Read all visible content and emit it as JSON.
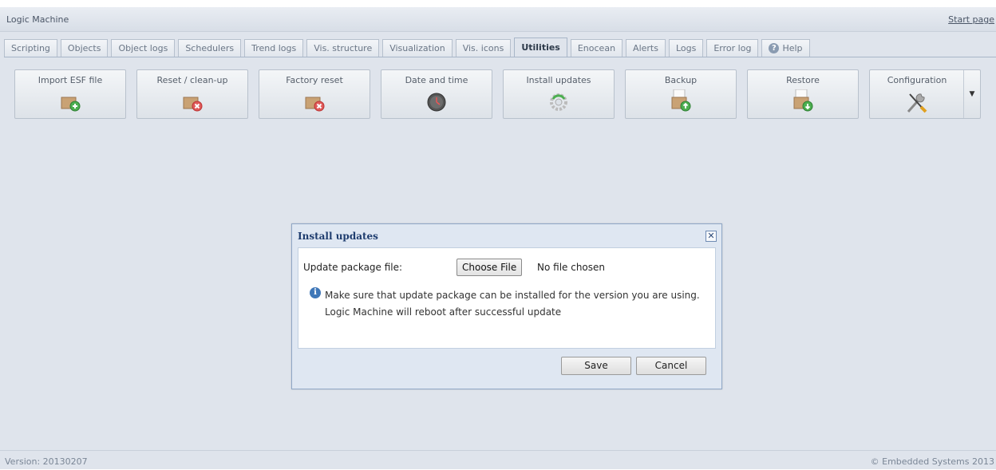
{
  "header": {
    "title": "Logic Machine",
    "start_page": "Start page"
  },
  "tabs": [
    {
      "label": "Scripting"
    },
    {
      "label": "Objects"
    },
    {
      "label": "Object logs"
    },
    {
      "label": "Schedulers"
    },
    {
      "label": "Trend logs"
    },
    {
      "label": "Vis. structure"
    },
    {
      "label": "Visualization"
    },
    {
      "label": "Vis. icons"
    },
    {
      "label": "Utilities",
      "active": true
    },
    {
      "label": "Enocean"
    },
    {
      "label": "Alerts"
    },
    {
      "label": "Logs"
    },
    {
      "label": "Error log"
    },
    {
      "label": "Help",
      "icon": "help-icon"
    }
  ],
  "toolbar": {
    "buttons": [
      {
        "label": "Import ESF file",
        "icon": "box-add-icon"
      },
      {
        "label": "Reset / clean-up",
        "icon": "box-remove-icon"
      },
      {
        "label": "Factory reset",
        "icon": "box-remove-icon"
      },
      {
        "label": "Date and time",
        "icon": "clock-icon"
      },
      {
        "label": "Install updates",
        "icon": "gear-refresh-icon"
      },
      {
        "label": "Backup",
        "icon": "box-upload-icon"
      },
      {
        "label": "Restore",
        "icon": "box-download-icon"
      },
      {
        "label": "Configuration",
        "icon": "tools-icon",
        "dropdown": true
      }
    ]
  },
  "dialog": {
    "title": "Install updates",
    "field_label": "Update package file:",
    "choose_file": "Choose File",
    "no_file": "No file chosen",
    "info": "Make sure that update package can be installed for the version you are using. Logic Machine will reboot after successful update",
    "save": "Save",
    "cancel": "Cancel"
  },
  "footer": {
    "version": "Version: 20130207",
    "copyright": "© Embedded Systems 2013"
  },
  "colors": {
    "background": "#dfe4ec",
    "dialog_title": "#1e3c6e",
    "info_icon": "#3f77b8"
  }
}
